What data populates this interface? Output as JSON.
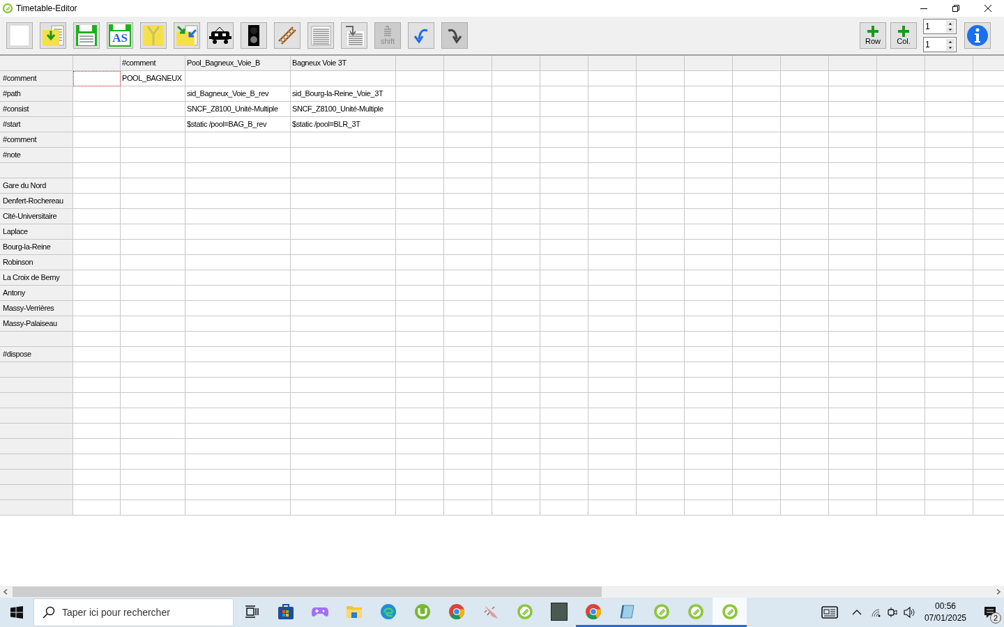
{
  "window": {
    "title": "Timetable-Editor"
  },
  "toolbar": {
    "buttons": [
      {
        "kind": "new",
        "disabled": false
      },
      {
        "kind": "open",
        "disabled": false
      },
      {
        "kind": "save",
        "disabled": false
      },
      {
        "kind": "save-as",
        "label": "AS",
        "disabled": false
      },
      {
        "kind": "zip",
        "disabled": false
      },
      {
        "kind": "import",
        "disabled": false
      },
      {
        "kind": "train",
        "disabled": false
      },
      {
        "kind": "signal",
        "disabled": false
      },
      {
        "kind": "track",
        "disabled": false
      },
      {
        "kind": "list",
        "disabled": false
      },
      {
        "kind": "insert",
        "disabled": false
      },
      {
        "kind": "shift",
        "label": "shift",
        "disabled": true
      },
      {
        "kind": "undo",
        "disabled": false
      },
      {
        "kind": "redo",
        "disabled": true
      }
    ],
    "add_row": {
      "label": "Row"
    },
    "add_column": {
      "label": "Col."
    },
    "spinners": [
      {
        "value": "1"
      },
      {
        "value": "1"
      }
    ]
  },
  "table": {
    "column_headings": [
      "#comment",
      "Pool_Bagneux_Voie_B",
      "Bagneux Voie 3T"
    ],
    "rows": [
      {
        "label": "#comment",
        "cells": [
          null,
          "POOL_BAGNEUX"
        ],
        "focused": true
      },
      {
        "label": "#path",
        "cells": [
          null,
          null,
          "sid_Bagneux_Voie_B_rev",
          "sid_Bourg-la-Reine_Voie_3T"
        ],
        "focused": false
      },
      {
        "label": "#consist",
        "cells": [
          null,
          null,
          "SNCF_Z8100_Unité-Multiple",
          "SNCF_Z8100_Unité-Multiple"
        ],
        "focused": false
      },
      {
        "label": "#start",
        "cells": [
          null,
          null,
          "$static /pool=BAG_B_rev",
          "$static /pool=BLR_3T"
        ],
        "focused": false
      },
      {
        "label": "#comment",
        "focused": false
      },
      {
        "label": "#note",
        "focused": false
      },
      {
        "focused": false
      },
      {
        "label": "Gare du Nord",
        "focused": false
      },
      {
        "label": "Denfert-Rochereau",
        "focused": false
      },
      {
        "label": "Cité-Universitaire",
        "focused": false
      },
      {
        "label": "Laplace",
        "focused": false
      },
      {
        "label": "Bourg-la-Reine",
        "focused": false
      },
      {
        "label": "Robinson",
        "focused": false
      },
      {
        "label": "La Croix de Berny",
        "focused": false
      },
      {
        "label": "Antony",
        "focused": false
      },
      {
        "label": "Massy-Verrières",
        "focused": false
      },
      {
        "label": "Massy-Palaiseau",
        "focused": false
      },
      {
        "focused": false
      },
      {
        "label": "#dispose",
        "focused": false
      },
      {
        "focused": false
      },
      {
        "focused": false
      },
      {
        "focused": false
      },
      {
        "focused": false
      },
      {
        "focused": false
      },
      {
        "focused": false
      },
      {
        "focused": false
      },
      {
        "focused": false
      },
      {
        "focused": false
      },
      {
        "focused": false
      }
    ]
  },
  "taskbar": {
    "search": {
      "placeholder": "Taper ici pour rechercher"
    },
    "apps": [
      {
        "kind": "taskview",
        "running": false,
        "active": false
      },
      {
        "kind": "store",
        "running": false,
        "active": false
      },
      {
        "kind": "gamepad",
        "running": false,
        "active": false
      },
      {
        "kind": "folder",
        "running": false,
        "active": false
      },
      {
        "kind": "edge",
        "running": false,
        "active": false
      },
      {
        "kind": "torrent",
        "running": false,
        "active": false
      },
      {
        "kind": "chrome",
        "running": false,
        "active": false
      },
      {
        "kind": "creature",
        "running": false,
        "active": false
      },
      {
        "kind": "ring",
        "running": false,
        "active": false
      },
      {
        "kind": "photo",
        "running": false,
        "active": false
      },
      {
        "kind": "chrome",
        "running": true,
        "active": false
      },
      {
        "kind": "notepad",
        "running": true,
        "active": false
      },
      {
        "kind": "ring",
        "running": true,
        "active": false
      },
      {
        "kind": "ring",
        "running": true,
        "active": false
      },
      {
        "kind": "ring",
        "running": true,
        "active": true
      }
    ],
    "time": "00:56",
    "date": "07/01/2025",
    "notifications": "2"
  }
}
